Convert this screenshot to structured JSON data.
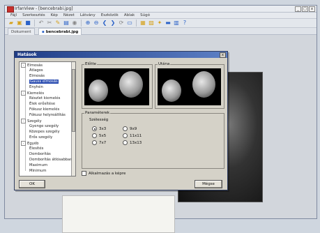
{
  "window": {
    "title": "IrfanView - [bencebrabi.jpg]",
    "controls": [
      "_",
      "□",
      "x"
    ]
  },
  "menu": [
    "Fájl",
    "Szerkesztés",
    "Kép",
    "Nézet",
    "Látvány",
    "Eszközök",
    "Ablak",
    "Súgó"
  ],
  "tabs": [
    {
      "label": "Dokument"
    },
    {
      "label": "bencebrabi.jpg",
      "active": true
    }
  ],
  "dialog": {
    "title": "Hatások",
    "tree": [
      {
        "label": "Elmosás",
        "level": 0,
        "expander": "-"
      },
      {
        "label": "Átlagos",
        "level": 1
      },
      {
        "label": "Elmosás",
        "level": 1
      },
      {
        "label": "Gauss elmosás",
        "level": 1,
        "selected": true
      },
      {
        "label": "Enyhén",
        "level": 1
      },
      {
        "label": "Kiemelés",
        "level": 0,
        "expander": "-"
      },
      {
        "label": "Részlet kiemelés",
        "level": 1
      },
      {
        "label": "Élek erősítése",
        "level": 1
      },
      {
        "label": "Fókusz kiemelés",
        "level": 1
      },
      {
        "label": "Fókusz helyreállítás",
        "level": 1
      },
      {
        "label": "Szegély",
        "level": 0,
        "expander": "-"
      },
      {
        "label": "Gyenge szegély",
        "level": 1
      },
      {
        "label": "Közepes szegély",
        "level": 1
      },
      {
        "label": "Erős szegély",
        "level": 1
      },
      {
        "label": "Egyéb",
        "level": 0,
        "expander": "-"
      },
      {
        "label": "Élesítés",
        "level": 1
      },
      {
        "label": "Domborítás",
        "level": 1
      },
      {
        "label": "Domborítás átlósabban",
        "level": 1
      },
      {
        "label": "Maximum",
        "level": 1
      },
      {
        "label": "Minimum",
        "level": 1
      }
    ],
    "before_label": "Előtte",
    "after_label": "Utána",
    "params_label": "Paraméterek",
    "width_label": "Szélesség",
    "radios": [
      {
        "label": "3x3",
        "checked": true
      },
      {
        "label": "9x9",
        "checked": false
      },
      {
        "label": "5x5",
        "checked": false
      },
      {
        "label": "11x11",
        "checked": false
      },
      {
        "label": "7x7",
        "checked": false
      },
      {
        "label": "13x13",
        "checked": false
      }
    ],
    "apply_checkbox": "Alkalmazás a képre",
    "ok_button": "OK",
    "cancel_button": "Mégse"
  }
}
